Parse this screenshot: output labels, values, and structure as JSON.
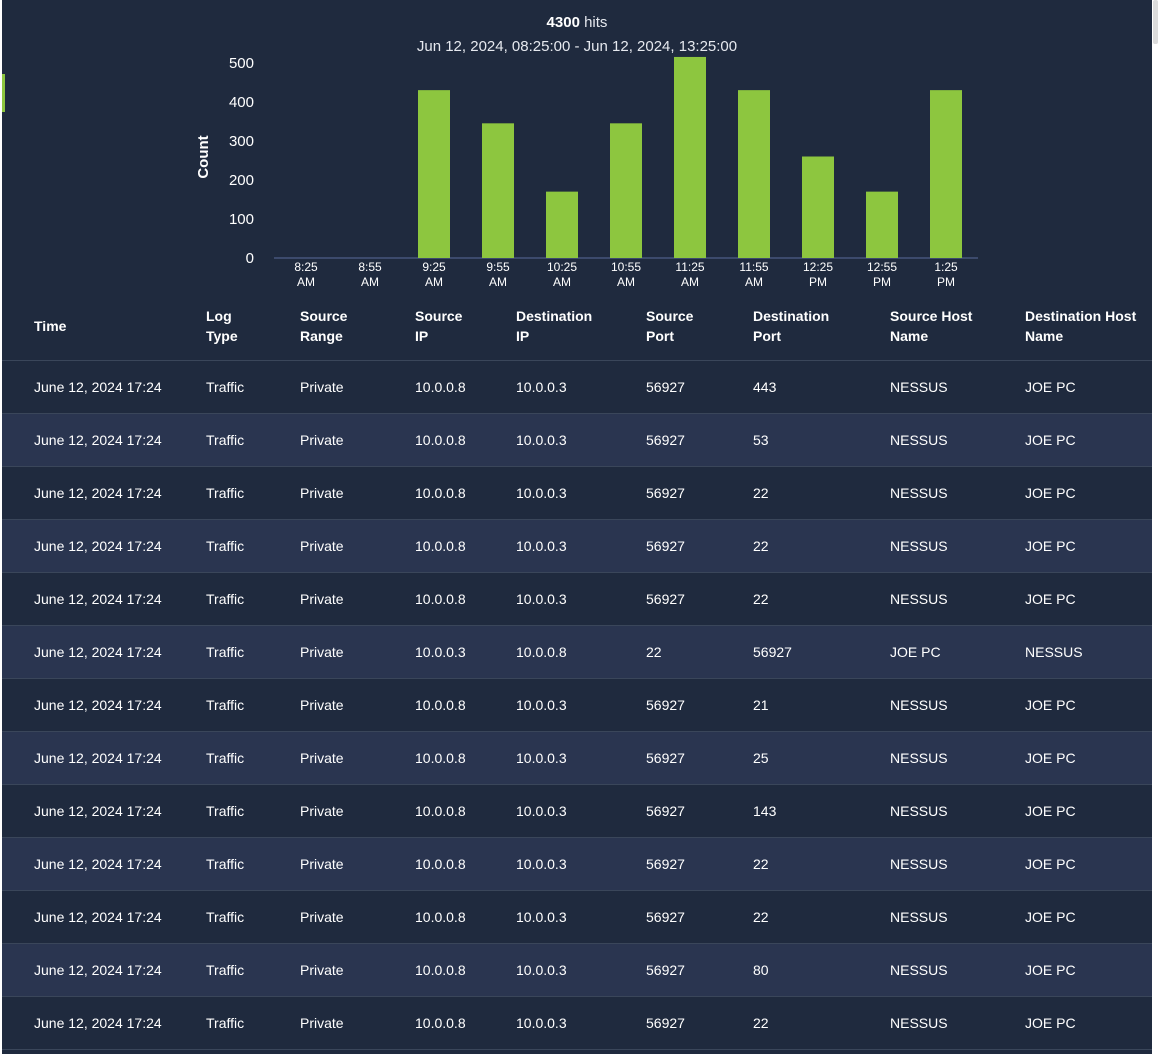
{
  "chart": {
    "hits_count": "4300",
    "hits_label": "hits",
    "range": "Jun 12, 2024, 08:25:00 - Jun 12, 2024, 13:25:00",
    "bar_color": "#8dc63f"
  },
  "chart_data": {
    "type": "bar",
    "categories": [
      "8:25 AM",
      "8:55 AM",
      "9:25 AM",
      "9:55 AM",
      "10:25 AM",
      "10:55 AM",
      "11:25 AM",
      "11:55 AM",
      "12:25 PM",
      "12:55 PM",
      "1:25 PM"
    ],
    "category_lines": [
      [
        "8:25",
        "AM"
      ],
      [
        "8:55",
        "AM"
      ],
      [
        "9:25",
        "AM"
      ],
      [
        "9:55",
        "AM"
      ],
      [
        "10:25",
        "AM"
      ],
      [
        "10:55",
        "AM"
      ],
      [
        "11:25",
        "AM"
      ],
      [
        "11:55",
        "AM"
      ],
      [
        "12:25",
        "PM"
      ],
      [
        "12:55",
        "PM"
      ],
      [
        "1:25",
        "PM"
      ]
    ],
    "values": [
      0,
      0,
      430,
      345,
      170,
      345,
      515,
      430,
      260,
      170,
      430
    ],
    "ylabel": "Count",
    "xlabel": "",
    "yticks": [
      0,
      100,
      200,
      300,
      400,
      500
    ],
    "ylim": [
      0,
      520
    ],
    "grid": false
  },
  "table": {
    "headers": [
      [
        "Time"
      ],
      [
        "Log",
        "Type"
      ],
      [
        "Source",
        "Range"
      ],
      [
        "Source",
        "IP"
      ],
      [
        "Destination",
        "IP"
      ],
      [
        "Source",
        "Port"
      ],
      [
        "Destination",
        "Port"
      ],
      [
        "Source Host",
        "Name"
      ],
      [
        "Destination Host",
        "Name"
      ]
    ],
    "rows": [
      [
        "June 12, 2024 17:24",
        "Traffic",
        "Private",
        "10.0.0.8",
        "10.0.0.3",
        "56927",
        "443",
        "NESSUS",
        "JOE PC"
      ],
      [
        "June 12, 2024 17:24",
        "Traffic",
        "Private",
        "10.0.0.8",
        "10.0.0.3",
        "56927",
        "53",
        "NESSUS",
        "JOE PC"
      ],
      [
        "June 12, 2024 17:24",
        "Traffic",
        "Private",
        "10.0.0.8",
        "10.0.0.3",
        "56927",
        "22",
        "NESSUS",
        "JOE PC"
      ],
      [
        "June 12, 2024 17:24",
        "Traffic",
        "Private",
        "10.0.0.8",
        "10.0.0.3",
        "56927",
        "22",
        "NESSUS",
        "JOE PC"
      ],
      [
        "June 12, 2024 17:24",
        "Traffic",
        "Private",
        "10.0.0.8",
        "10.0.0.3",
        "56927",
        "22",
        "NESSUS",
        "JOE PC"
      ],
      [
        "June 12, 2024 17:24",
        "Traffic",
        "Private",
        "10.0.0.3",
        "10.0.0.8",
        "22",
        "56927",
        "JOE PC",
        "NESSUS"
      ],
      [
        "June 12, 2024 17:24",
        "Traffic",
        "Private",
        "10.0.0.8",
        "10.0.0.3",
        "56927",
        "21",
        "NESSUS",
        "JOE PC"
      ],
      [
        "June 12, 2024 17:24",
        "Traffic",
        "Private",
        "10.0.0.8",
        "10.0.0.3",
        "56927",
        "25",
        "NESSUS",
        "JOE PC"
      ],
      [
        "June 12, 2024 17:24",
        "Traffic",
        "Private",
        "10.0.0.8",
        "10.0.0.3",
        "56927",
        "143",
        "NESSUS",
        "JOE PC"
      ],
      [
        "June 12, 2024 17:24",
        "Traffic",
        "Private",
        "10.0.0.8",
        "10.0.0.3",
        "56927",
        "22",
        "NESSUS",
        "JOE PC"
      ],
      [
        "June 12, 2024 17:24",
        "Traffic",
        "Private",
        "10.0.0.8",
        "10.0.0.3",
        "56927",
        "22",
        "NESSUS",
        "JOE PC"
      ],
      [
        "June 12, 2024 17:24",
        "Traffic",
        "Private",
        "10.0.0.8",
        "10.0.0.3",
        "56927",
        "80",
        "NESSUS",
        "JOE PC"
      ],
      [
        "June 12, 2024 17:24",
        "Traffic",
        "Private",
        "10.0.0.8",
        "10.0.0.3",
        "56927",
        "22",
        "NESSUS",
        "JOE PC"
      ]
    ]
  }
}
